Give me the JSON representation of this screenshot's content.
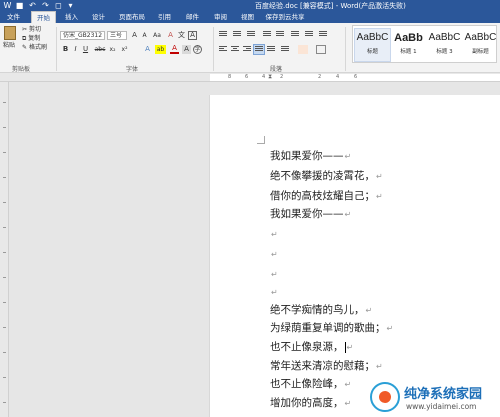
{
  "window": {
    "title": "百度经验.doc [兼容模式] - Word(产品激活失败)"
  },
  "ribbon_tabs": [
    "文件",
    "开始",
    "插入",
    "设计",
    "页面布局",
    "引用",
    "邮件",
    "审阅",
    "视图",
    "保存到云共享"
  ],
  "clipboard": {
    "paste": "粘贴",
    "cut": "剪切",
    "copy": "复制",
    "format_painter": "格式刷",
    "group_label": "剪贴板"
  },
  "font": {
    "name": "仿宋_GB2312",
    "size": "三号",
    "grow": "A",
    "shrink": "A",
    "case": "Aa",
    "clear": "A",
    "phonetic": "文",
    "border": "A",
    "bold": "B",
    "italic": "I",
    "underline": "U",
    "strike": "abc",
    "subscript": "x₂",
    "superscript": "x²",
    "effects": "A",
    "highlight": "ab",
    "color": "A",
    "shade": "A",
    "enclose": "字",
    "group_label": "字体"
  },
  "paragraph": {
    "group_label": "段落"
  },
  "styles": {
    "items": [
      {
        "sample": "AaBbC",
        "name": "标题"
      },
      {
        "sample": "AaBb",
        "name": "标题 1"
      },
      {
        "sample": "AaBbC",
        "name": "标题 3"
      },
      {
        "sample": "AaBbC",
        "name": "副标题"
      }
    ]
  },
  "ruler_numbers": [
    "8",
    "6",
    "4",
    "2",
    "2",
    "4",
    "6"
  ],
  "document": {
    "lines": [
      "我如果爱你——",
      "绝不像攀援的凌霄花，",
      "借你的高枝炫耀自己；",
      "我如果爱你——",
      "",
      "",
      "",
      "",
      "绝不学痴情的鸟儿，",
      "为绿荫重复单调的歌曲；",
      "也不止像泉源，",
      "常年送来清凉的慰藉；",
      "也不止像险峰，",
      "增加你的高度，"
    ],
    "paragraph_mark": "↵"
  },
  "watermark": {
    "name": "纯净系统家园",
    "url": "www.yidaimei.com"
  },
  "colors": {
    "title_bar": "#2b579a",
    "ribbon": "#f3f3f3",
    "page": "#ffffff",
    "canvas": "#e6e6e6"
  }
}
